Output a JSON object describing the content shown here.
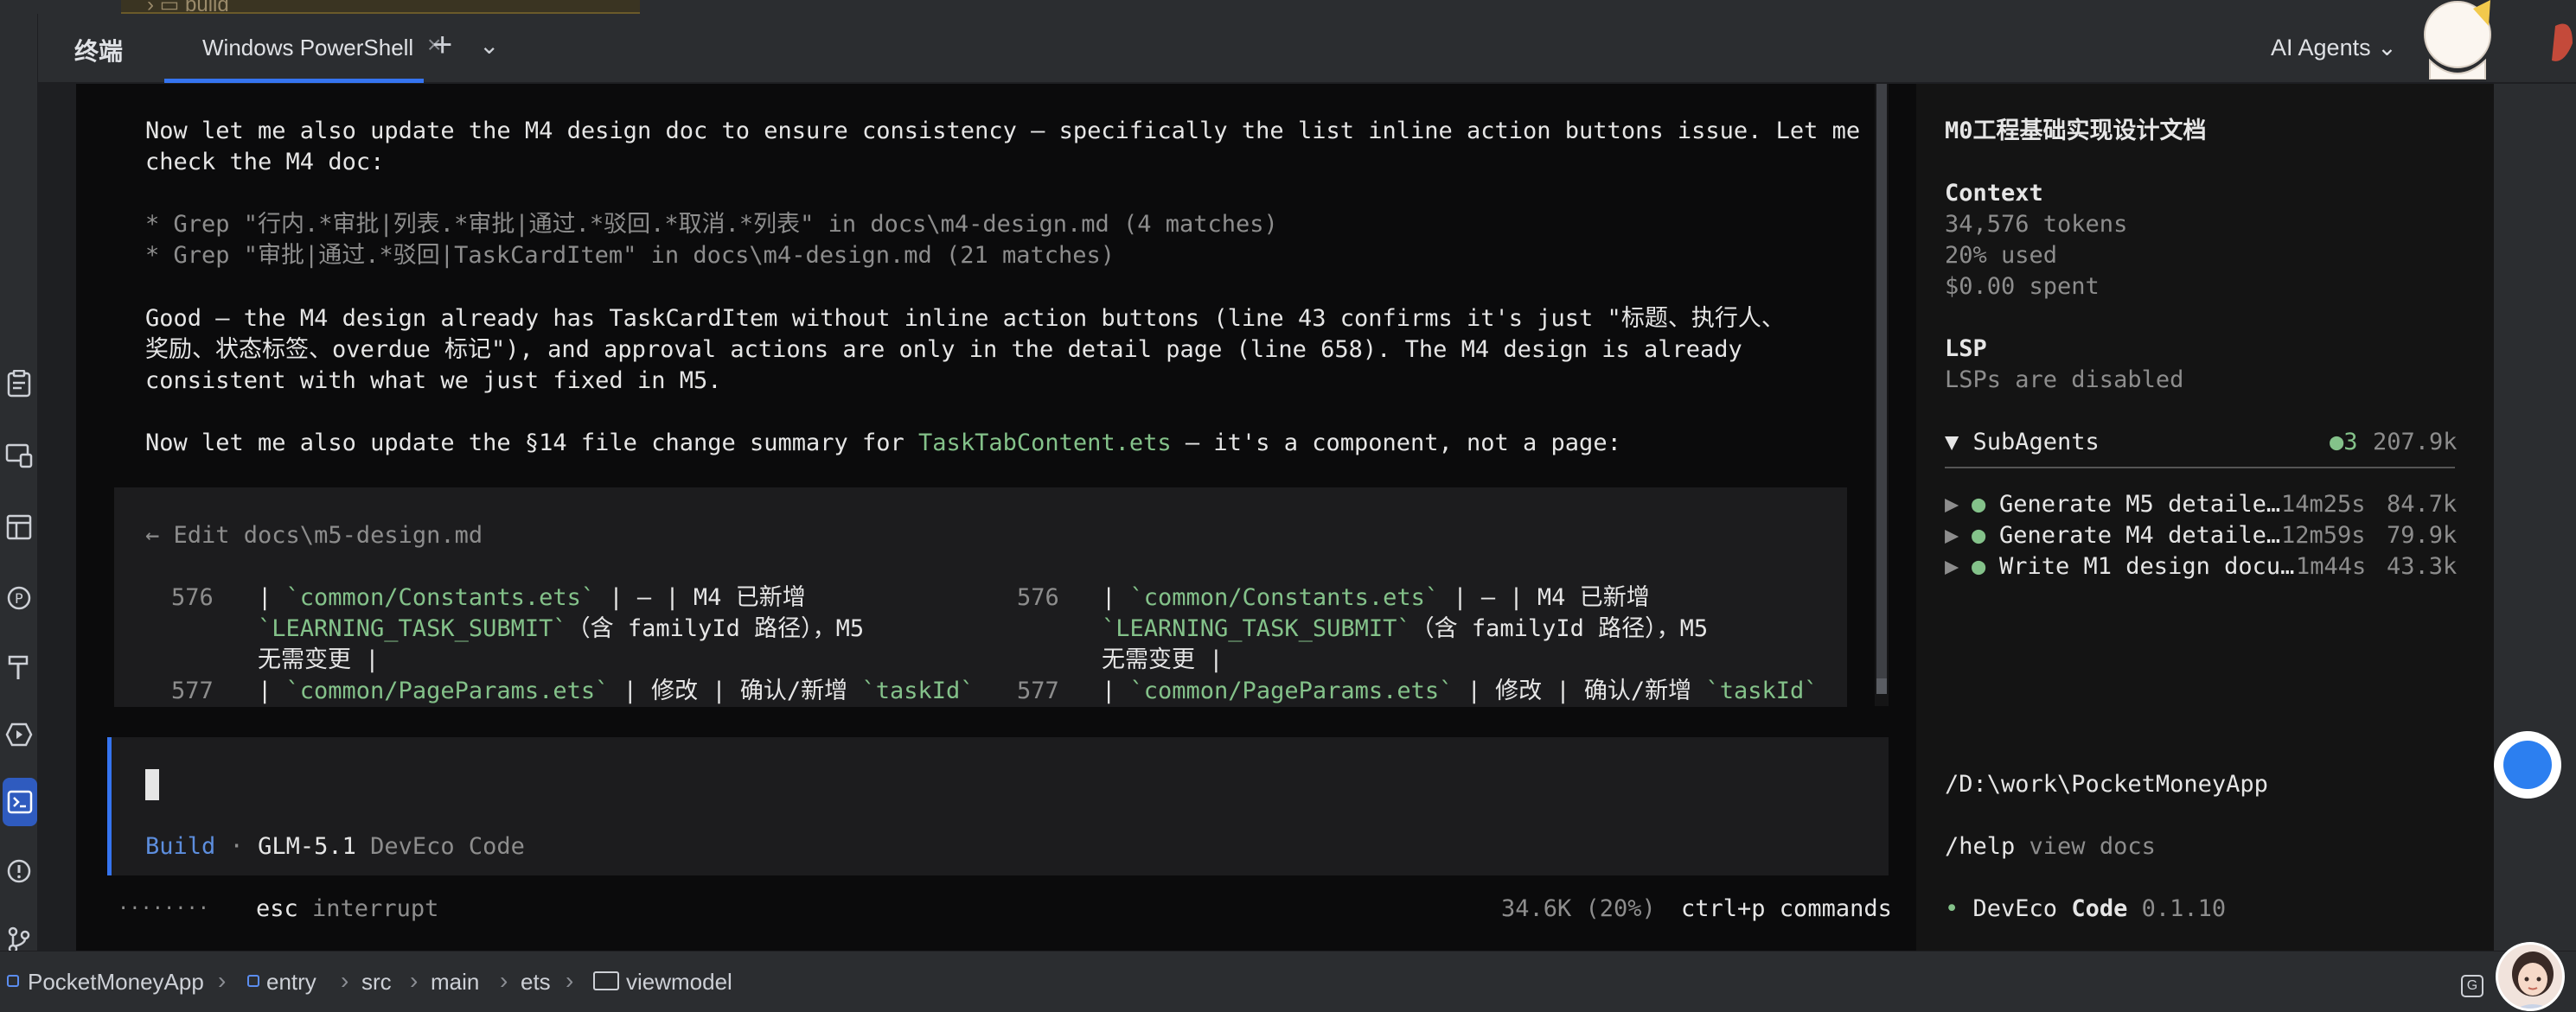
{
  "file_tree": {
    "partial_item": "build"
  },
  "tool_window": {
    "title": "终端",
    "tab_label": "Windows PowerShell",
    "tab_close": "×",
    "add": "+",
    "more": "⌄",
    "agents_menu": "AI Agents ⌄",
    "options": "⋮"
  },
  "terminal": {
    "lines": {
      "l1": "Now let me also update the M4 design doc to ensure consistency — specifically the list inline action buttons issue. Let me",
      "l2": "check the M4 doc:",
      "grep1": "* Grep \"行内.*审批|列表.*审批|通过.*驳回.*取消.*列表\" in docs\\m4-design.md (4 matches)",
      "grep2": "* Grep \"审批|通过.*驳回|TaskCardItem\" in docs\\m4-design.md (21 matches)",
      "g1": "Good — the M4 design already has TaskCardItem without inline action buttons (line 43 confirms it's just \"标题、执行人、",
      "g2": "奖励、状态标签、overdue 标记\"), and approval actions are only in the detail page (line 658). The M4 design is already",
      "g3": "consistent with what we just fixed in M5.",
      "n1_pre": "Now let me also update the §14 file change summary for ",
      "n1_file": "TaskTabContent.ets",
      "n1_post": " — it's a component, not a page:"
    },
    "diff": {
      "header": "← Edit docs\\m5-design.md",
      "left": {
        "r1_num": "576",
        "r1_a": "| ",
        "r1_b": "`common/Constants.ets`",
        "r1_c": " | — | M4 已新增",
        "r1_d": "`LEARNING_TASK_SUBMIT`",
        "r1_e": "（含 familyId 路径），M5",
        "r1_f": "无需变更 |",
        "r2_num": "577",
        "r2_a": "| ",
        "r2_b": "`common/PageParams.ets`",
        "r2_c": " | 修改 | 确认/新增 ",
        "r2_d": "`taskId`"
      },
      "right": {
        "r1_num": "576",
        "r1_a": "| ",
        "r1_b": "`common/Constants.ets`",
        "r1_c": " | — | M4 已新增",
        "r1_d": "`LEARNING_TASK_SUBMIT`",
        "r1_e": "（含 familyId 路径），M5",
        "r1_f": "无需变更 |",
        "r2_num": "577",
        "r2_a": "| ",
        "r2_b": "`common/PageParams.ets`",
        "r2_c": " | 修改 | 确认/新增 ",
        "r2_d": "`taskId`"
      }
    },
    "prompt": {
      "mode": "Build",
      "sep": " · ",
      "model": "GLM-5.1",
      "app": " DevEco Code"
    },
    "footer": {
      "spinner": "········",
      "esc_key": "esc",
      "esc_label": " interrupt",
      "tokens": "34.6K (20%)",
      "cmd_key": "ctrl+p",
      "cmd_label": " commands"
    }
  },
  "sidebar": {
    "title": "M0工程基础实现设计文档",
    "context": {
      "heading": "Context",
      "tokens": "34,576 tokens",
      "used": "20% used",
      "spent": "$0.00 spent"
    },
    "lsp": {
      "heading": "LSP",
      "status": "LSPs are disabled"
    },
    "subagents": {
      "heading": "▼ SubAgents",
      "count": "●3",
      "total": "207.9k",
      "items": [
        {
          "name": "Generate M5 detaile…",
          "time": "14m25s",
          "tokens": "84.7k"
        },
        {
          "name": "Generate M4 detaile…",
          "time": "12m59s",
          "tokens": "79.9k"
        },
        {
          "name": "Write M1 design docu…",
          "time": "1m44s",
          "tokens": "43.3k"
        }
      ]
    },
    "path": "/D:\\work\\PocketMoneyApp",
    "help_cmd": "/help",
    "help_label": " view docs",
    "version_bullet": "•",
    "version_name_a": " DevEco ",
    "version_name_b": "Code",
    "version_num": " 0.1.10"
  },
  "breadcrumb": {
    "items": [
      "PocketMoneyApp",
      "entry",
      "src",
      "main",
      "ets",
      "viewmodel"
    ],
    "sep": "›"
  },
  "colors": {
    "accent": "#3574f0",
    "terminal_bg": "#0b0b0c",
    "green_code": "#84c28a",
    "subagent_dot": "#84c28a"
  }
}
